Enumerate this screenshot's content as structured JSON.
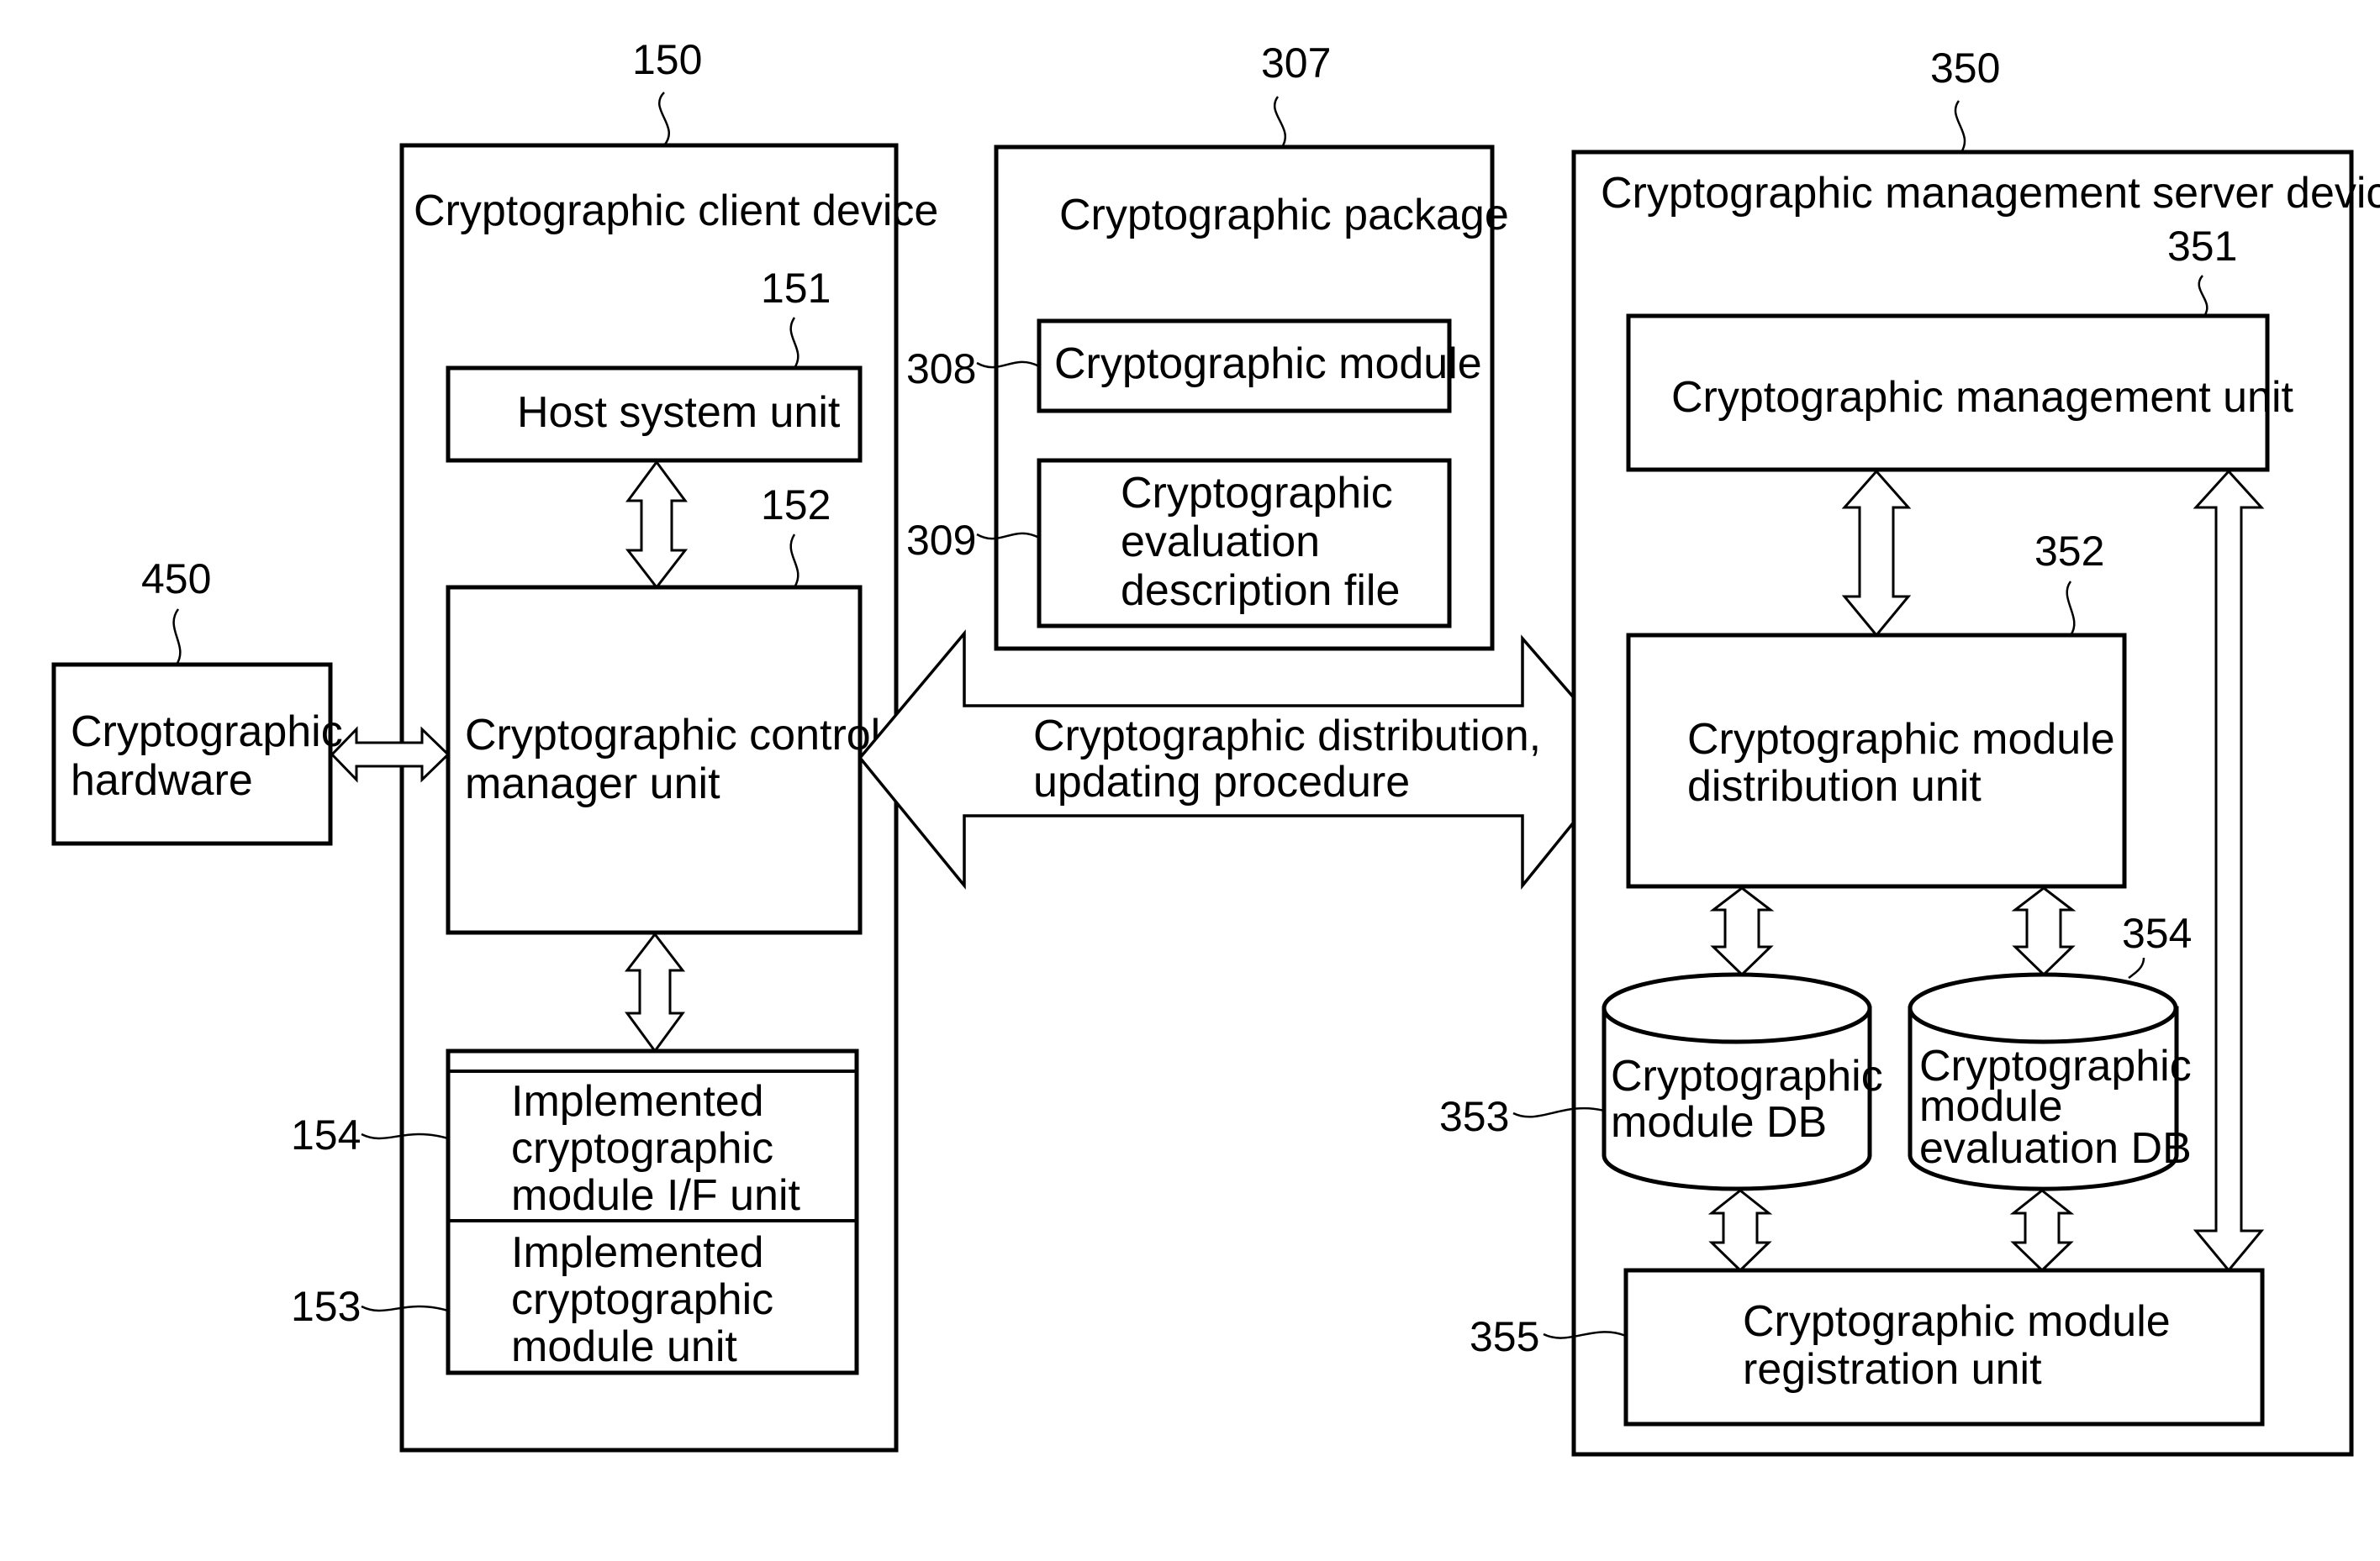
{
  "diagram": {
    "client_device": {
      "ref": "150",
      "title": "Cryptographic client device",
      "host_system": {
        "ref": "151",
        "label": "Host system unit"
      },
      "control_manager": {
        "ref": "152",
        "line1": "Cryptographic control",
        "line2": "manager unit"
      },
      "module_if": {
        "ref": "154",
        "line1": "Implemented",
        "line2": "cryptographic",
        "line3": "module I/F unit"
      },
      "module_unit": {
        "ref": "153",
        "line1": "Implemented",
        "line2": "cryptographic",
        "line3": "module unit"
      }
    },
    "hardware": {
      "ref": "450",
      "line1": "Cryptographic",
      "line2": "hardware"
    },
    "package": {
      "ref": "307",
      "title": "Cryptographic package",
      "module": {
        "ref": "308",
        "label": "Cryptographic module"
      },
      "evaluation_file": {
        "ref": "309",
        "line1": "Cryptographic",
        "line2": "evaluation",
        "line3": "description file"
      }
    },
    "procedure": {
      "line1": "Cryptographic distribution,",
      "line2": "updating procedure"
    },
    "server_device": {
      "ref": "350",
      "title": "Cryptographic management server device",
      "management_unit": {
        "ref": "351",
        "label": "Cryptographic management unit"
      },
      "distribution_unit": {
        "ref": "352",
        "line1": "Cryptographic module",
        "line2": "distribution unit"
      },
      "module_db": {
        "ref": "353",
        "line1": "Cryptographic",
        "line2": "module DB"
      },
      "evaluation_db": {
        "ref": "354",
        "line1": "Cryptographic",
        "line2": "module",
        "line3": "evaluation DB"
      },
      "registration_unit": {
        "ref": "355",
        "line1": "Cryptographic module",
        "line2": "registration unit"
      }
    }
  }
}
